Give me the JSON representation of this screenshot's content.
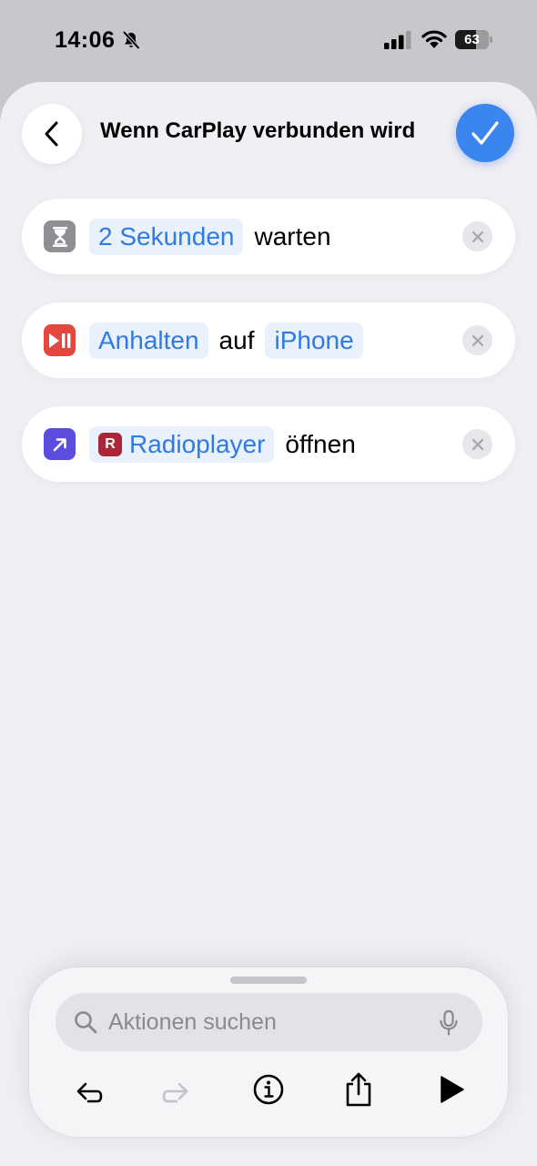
{
  "status_bar": {
    "time": "14:06",
    "battery": "63",
    "battery_level": 0.63
  },
  "header": {
    "title": "Wenn CarPlay verbunden wird"
  },
  "actions": [
    {
      "icon": "hourglass-icon",
      "icon_color": "#8e8e93",
      "token": "2 Sekunden",
      "text": "warten"
    },
    {
      "icon": "play-pause-icon",
      "icon_color": "#e5473f",
      "token": "Anhalten",
      "text": "auf",
      "token2": "iPhone"
    },
    {
      "icon": "open-app-icon",
      "icon_color": "#5b4de0",
      "app_icon": "radioplayer-app-icon",
      "app_letter": "R",
      "token": "Radioplayer",
      "text": "öffnen"
    }
  ],
  "search": {
    "placeholder": "Aktionen suchen"
  },
  "toolbar": [
    "undo-icon",
    "redo-icon",
    "info-icon",
    "share-icon",
    "play-icon"
  ],
  "colors": {
    "accent": "#2f7ae5",
    "done_button": "#3a86ee",
    "token_background": "#e9f1fc"
  }
}
